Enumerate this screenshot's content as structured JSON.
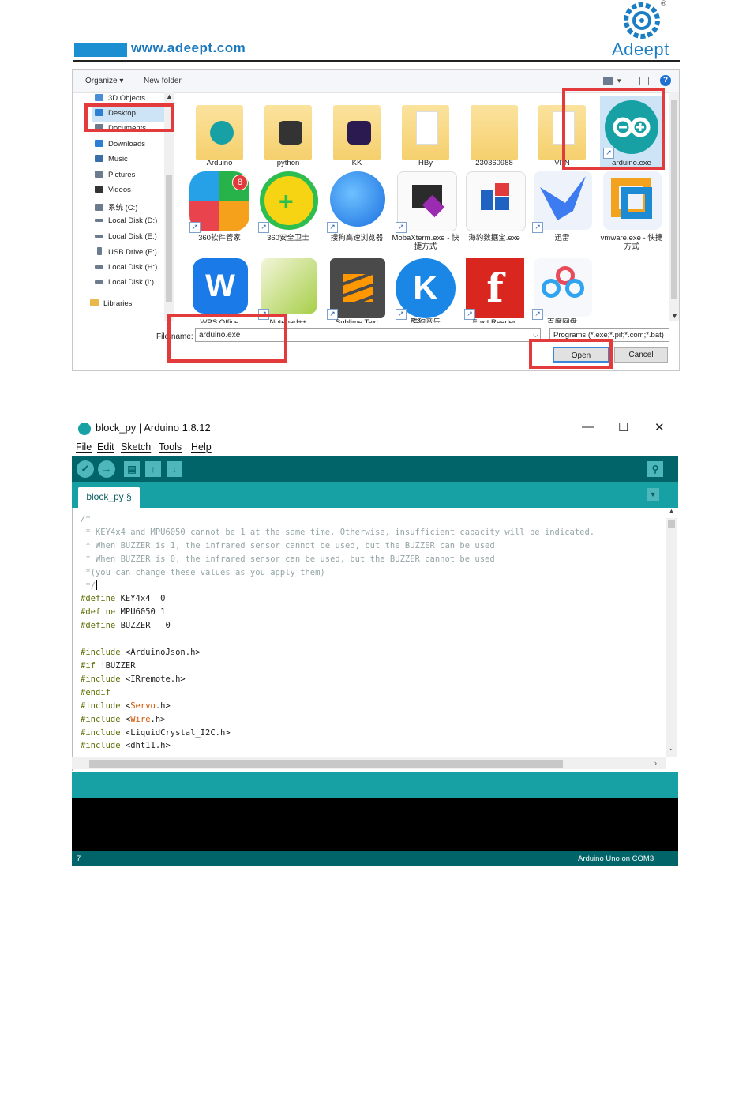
{
  "header": {
    "url": "www.adeept.com",
    "brand": "Adeept",
    "registered_mark": "®",
    "colors": {
      "brand_blue": "#1b8fd2"
    }
  },
  "file_dialog": {
    "toolbar": {
      "organize": "Organize ▾",
      "new_folder": "New folder",
      "help": "?"
    },
    "nav_items": [
      "3D Objects",
      "Desktop",
      "Documents",
      "Downloads",
      "Music",
      "Pictures",
      "Videos",
      "系统 (C:)",
      "Local Disk (D:)",
      "Local Disk (E:)",
      "USB Drive (F:)",
      "Local Disk (H:)",
      "Local Disk (I:)",
      "Libraries"
    ],
    "selected_nav": "Desktop",
    "files_row1": [
      "Arduino",
      "python",
      "KK",
      "HBy",
      "230360988",
      "VPN",
      "arduino.exe"
    ],
    "files_row2": [
      "360软件管家",
      "360安全卫士",
      "搜狗高速浏览器",
      "MobaXterm.exe - 快捷方式",
      "海豹数据宝.exe",
      "迅雷",
      "vmware.exe - 快捷方式"
    ],
    "files_row3": [
      "WPS Office",
      "Notepad++",
      "Sublime Text",
      "酷狗音乐",
      "Foxit Reader",
      "百度网盘"
    ],
    "badge_count": "8",
    "filename_label": "File name:",
    "filename_value": "arduino.exe",
    "filetype_value": "Programs (*.exe;*.pif;*.com;*.bat)",
    "open_button": "Open",
    "cancel_button": "Cancel"
  },
  "ide": {
    "title": "block_py | Arduino 1.8.12",
    "window_controls": {
      "minimize": "—",
      "maximize": "☐",
      "close": "✕"
    },
    "menu": [
      "File",
      "Edit",
      "Sketch",
      "Tools",
      "Help"
    ],
    "toolbar": {
      "verify": "✓",
      "upload": "→",
      "new": "▤",
      "open": "↑",
      "save": "↓",
      "serial_monitor": "⚲"
    },
    "tab": "block_py §",
    "tab_menu": "▼",
    "code_lines": [
      "/*",
      " * KEY4x4 and MPU6050 cannot be 1 at the same time. Otherwise, insufficient capacity will be indicated.",
      " * When BUZZER is 1, the infrared sensor cannot be used, but the BUZZER can be used",
      " * When BUZZER is 0, the infrared sensor can be used, but the BUZZER cannot be used",
      " *(you can change these values as you apply them)",
      " */",
      "#define KEY4x4  0",
      "#define MPU6050 1",
      "#define BUZZER   0",
      "",
      "#include <ArduinoJson.h>",
      "#if !BUZZER",
      "#include <IRremote.h>",
      "#endif",
      "#include <Servo.h>",
      "#include <Wire.h>",
      "#include <LiquidCrystal_I2C.h>",
      "#include <dht11.h>"
    ],
    "footer_line": "7",
    "footer_board": "Arduino Uno on COM3",
    "colors": {
      "teal_dark": "#006468",
      "teal": "#17a1a5",
      "keyword": "#5e6d03",
      "comment": "#95a5a6",
      "library": "#d35400"
    }
  }
}
